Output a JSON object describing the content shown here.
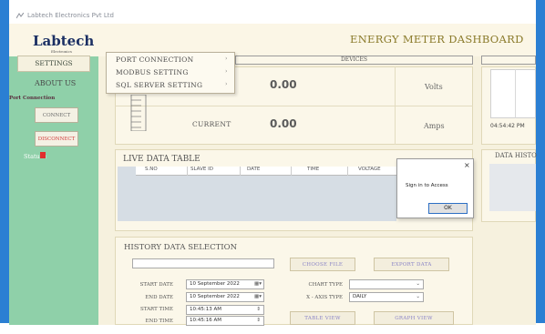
{
  "window": {
    "title": "Labtech Electronics Pvt Ltd"
  },
  "header": {
    "logo_text": "Labtech",
    "logo_sub": "Electronics",
    "title": "ENERGY METER DASHBOARD"
  },
  "sidebar": {
    "settings_label": "SETTINGS",
    "about_label": "ABOUT US",
    "port_connection_label": "Port Connection",
    "connect_label": "CONNECT",
    "disconnect_label": "DISCONNECT",
    "status_label": "Status :",
    "status_color": "#e12d2d"
  },
  "settings_menu": {
    "items": [
      {
        "label": "PORT CONNECTION",
        "arrow": "›"
      },
      {
        "label": "MODBUS SETTING",
        "arrow": "›"
      },
      {
        "label": "SQL SERVER SETTING",
        "arrow": "›"
      }
    ]
  },
  "devices": {
    "title": "DEVICES"
  },
  "readings": {
    "voltage": {
      "value": "0.00",
      "unit": "Volts"
    },
    "current": {
      "label": "CURRENT",
      "value": "0.00",
      "unit": "Amps"
    }
  },
  "graph": {
    "time_label": "04:54:42 PM"
  },
  "live_table": {
    "title": "LIVE DATA TABLE",
    "columns": [
      "S.NO",
      "SLAVE ID",
      "DATE",
      "TIME",
      "VOLTAGE"
    ]
  },
  "data_history": {
    "title": "DATA HISTO"
  },
  "dialog": {
    "close": "×",
    "message": "Sign in to Access",
    "ok_label": "OK"
  },
  "history": {
    "title": "HISTORY DATA SELECTION",
    "choose_file_label": "CHOOSE FILE",
    "export_label": "EXPORT DATA",
    "start_date_label": "START DATE",
    "start_date_value": "10 September 2022",
    "end_date_label": "END DATE",
    "end_date_value": "10 September 2022",
    "start_time_label": "START TIME",
    "start_time_value": "10:45:13 AM",
    "end_time_label": "END TIME",
    "end_time_value": "10:45:16 AM",
    "chart_type_label": "CHART TYPE",
    "xaxis_type_label": "X - AXIS TYPE",
    "xaxis_type_value": "DAILY",
    "table_view_label": "TABLE VIEW",
    "graph_view_label": "GRAPH VIEW"
  }
}
